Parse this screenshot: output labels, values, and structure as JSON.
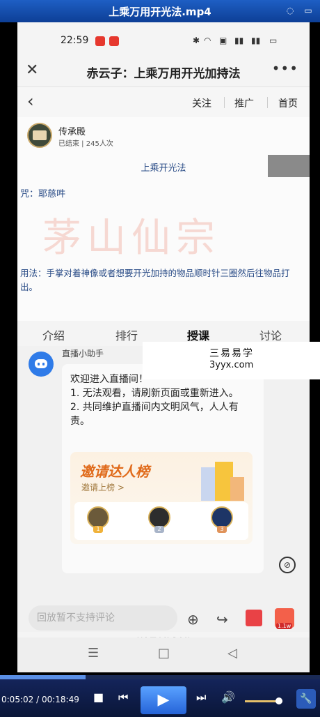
{
  "player": {
    "title": "上乘万用开光法.mp4",
    "current_time": "0:05:02",
    "total_time": "00:18:49",
    "progress": 0.268,
    "volume": 0.9
  },
  "phone_status": {
    "time": "22:59"
  },
  "nav": {
    "title": "赤云子：上乘万用开光加持法"
  },
  "subnav": {
    "follow": "关注",
    "promote": "推广",
    "home": "首页"
  },
  "stream": {
    "host_name": "传承殿",
    "host_stats": "已结束 | 245人次"
  },
  "slide": {
    "title": "上乘开光法",
    "mantra": "咒：耶慈吽",
    "watermark": "茅山仙宗",
    "usage": "用法：手掌对着神像或者想要开光加持的物品顺时针三圈然后往物品打出。"
  },
  "tabs": [
    {
      "label": "介绍",
      "active": false
    },
    {
      "label": "排行",
      "active": false
    },
    {
      "label": "授课",
      "active": true
    },
    {
      "label": "讨论",
      "active": false
    }
  ],
  "chat": {
    "assistant_name": "直播小助手",
    "message": "欢迎进入直播间！\n1. 无法观看，请刷新页面或重新进入。\n2. 共同维护直播间内文明风气，人人有责。",
    "rank_title": "邀请达人榜",
    "rank_link": "邀请上榜 >",
    "medals": [
      "1",
      "2",
      "3"
    ]
  },
  "comment": {
    "placeholder": "回放暂不支持评论",
    "badge": "1.1w",
    "support": "创客匠人技术支持"
  },
  "site_watermark": {
    "name": "三易易学",
    "url": "3yyx.com"
  },
  "colors": {
    "player_bar": "#0d3f96",
    "slide_text": "#2a4c87",
    "rank_title": "#e06a1a"
  }
}
